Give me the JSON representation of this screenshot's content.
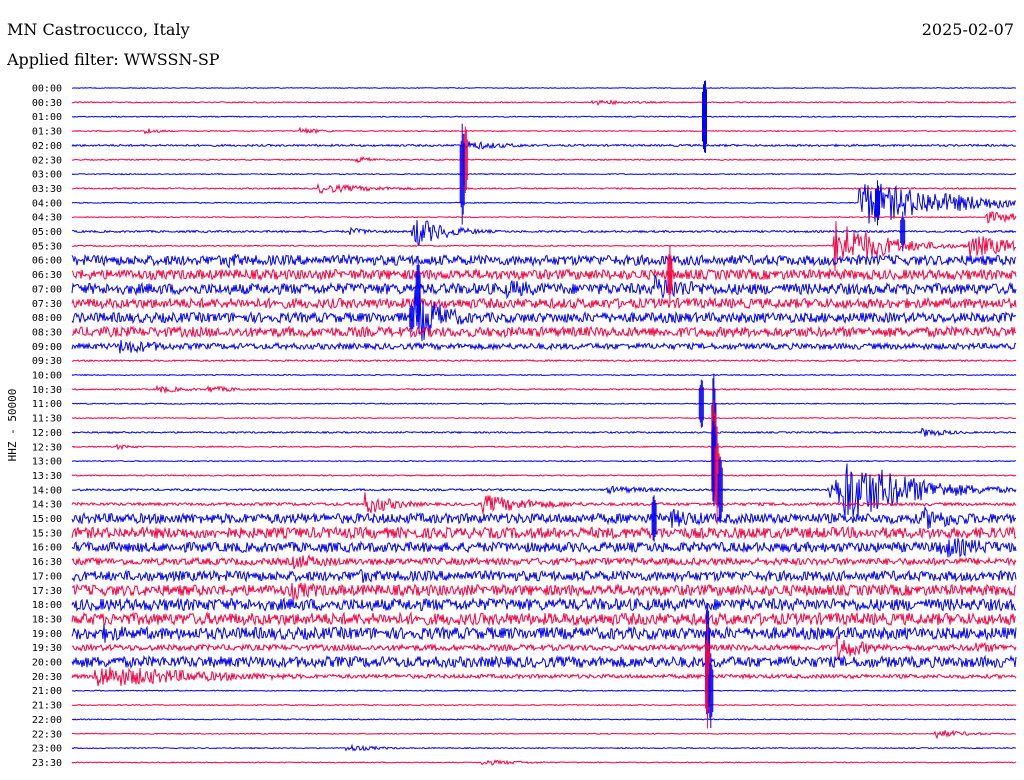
{
  "header": {
    "station": "MN Castrocucco, Italy",
    "date": "2025-02-07",
    "filter": "Applied filter: WWSSN-SP"
  },
  "chart_data": {
    "type": "helicorder",
    "ylabel": "HHZ - 50000",
    "row_colors": [
      "#0000ff",
      "#ff0040"
    ],
    "time_labels": [
      "00:00",
      "00:30",
      "01:00",
      "01:30",
      "02:00",
      "02:30",
      "03:00",
      "03:30",
      "04:00",
      "04:30",
      "05:00",
      "05:30",
      "06:00",
      "06:30",
      "07:00",
      "07:30",
      "08:00",
      "08:30",
      "09:00",
      "09:30",
      "10:00",
      "10:30",
      "11:00",
      "11:30",
      "12:00",
      "12:30",
      "13:00",
      "13:30",
      "14:00",
      "14:30",
      "15:00",
      "15:30",
      "16:00",
      "16:30",
      "17:00",
      "17:30",
      "18:00",
      "18:30",
      "19:00",
      "19:30",
      "20:00",
      "20:30",
      "21:00",
      "21:30",
      "22:00",
      "22:30",
      "23:00",
      "23:30"
    ],
    "row_minutes": 30,
    "noise_level": [
      0.4,
      0.6,
      0.5,
      0.5,
      1.0,
      0.6,
      0.5,
      0.7,
      0.5,
      0.5,
      1.0,
      0.6,
      5.0,
      5.0,
      5.5,
      5.0,
      5.0,
      5.0,
      3.0,
      0.8,
      0.5,
      0.7,
      0.5,
      0.5,
      0.8,
      0.6,
      0.5,
      0.6,
      1.0,
      1.5,
      5.0,
      5.5,
      5.0,
      3.5,
      5.0,
      5.5,
      6.0,
      6.0,
      6.0,
      3.0,
      5.5,
      2.0,
      0.5,
      0.5,
      0.5,
      0.5,
      0.5,
      0.5
    ],
    "events": [
      {
        "row": 1,
        "minute": 16.5,
        "amp": 3,
        "dur": 1.5
      },
      {
        "row": 3,
        "minute": 2.3,
        "amp": 4,
        "dur": 0.5
      },
      {
        "row": 3,
        "minute": 7.2,
        "amp": 4,
        "dur": 0.7
      },
      {
        "row": 4,
        "minute": 12.5,
        "amp": 5,
        "dur": 1.5
      },
      {
        "row": 5,
        "minute": 9.0,
        "amp": 4,
        "dur": 0.6
      },
      {
        "row": 7,
        "minute": 7.8,
        "amp": 5,
        "dur": 2.0
      },
      {
        "row": 8,
        "minute": 25.0,
        "amp": 24,
        "dur": 3.0
      },
      {
        "row": 9,
        "minute": 29.0,
        "amp": 6,
        "dur": 2.0
      },
      {
        "row": 10,
        "minute": 8.8,
        "amp": 4,
        "dur": 1.0
      },
      {
        "row": 10,
        "minute": 10.8,
        "amp": 18,
        "dur": 1.0
      },
      {
        "row": 11,
        "minute": 24.2,
        "amp": 28,
        "dur": 1.5
      },
      {
        "row": 11,
        "minute": 28.5,
        "amp": 12,
        "dur": 2.0
      },
      {
        "row": 12,
        "minute": 4.9,
        "amp": 9,
        "dur": 1.0
      },
      {
        "row": 14,
        "minute": 13.8,
        "amp": 10,
        "dur": 2.0
      },
      {
        "row": 14,
        "minute": 18.5,
        "amp": 14,
        "dur": 2.0
      },
      {
        "row": 16,
        "minute": 10.9,
        "amp": 30,
        "dur": 1.0
      },
      {
        "row": 18,
        "minute": 1.5,
        "amp": 8,
        "dur": 2.0
      },
      {
        "row": 21,
        "minute": 2.7,
        "amp": 4,
        "dur": 1.0
      },
      {
        "row": 21,
        "minute": 4.3,
        "amp": 4,
        "dur": 1.0
      },
      {
        "row": 24,
        "minute": 27.0,
        "amp": 5,
        "dur": 1.0
      },
      {
        "row": 25,
        "minute": 1.4,
        "amp": 3,
        "dur": 0.6
      },
      {
        "row": 28,
        "minute": 17.0,
        "amp": 4,
        "dur": 2.0
      },
      {
        "row": 28,
        "minute": 24.0,
        "amp": 16,
        "dur": 2.5
      },
      {
        "row": 28,
        "minute": 24.5,
        "amp": 38,
        "dur": 2.0
      },
      {
        "row": 28,
        "minute": 25.0,
        "amp": 14,
        "dur": 2.0
      },
      {
        "row": 29,
        "minute": 9.3,
        "amp": 12,
        "dur": 1.0
      },
      {
        "row": 29,
        "minute": 13.0,
        "amp": 10,
        "dur": 2.0
      },
      {
        "row": 30,
        "minute": 19.0,
        "amp": 10,
        "dur": 2.0
      },
      {
        "row": 30,
        "minute": 27.0,
        "amp": 12,
        "dur": 2.0
      },
      {
        "row": 32,
        "minute": 5.3,
        "amp": 6,
        "dur": 1.0
      },
      {
        "row": 32,
        "minute": 27.5,
        "amp": 12,
        "dur": 2.5
      },
      {
        "row": 33,
        "minute": 7.0,
        "amp": 8,
        "dur": 2.0
      },
      {
        "row": 34,
        "minute": 9.0,
        "amp": 8,
        "dur": 2.0
      },
      {
        "row": 35,
        "minute": 6.9,
        "amp": 10,
        "dur": 2.0
      },
      {
        "row": 38,
        "minute": 1.0,
        "amp": 10,
        "dur": 1.5
      },
      {
        "row": 39,
        "minute": 24.3,
        "amp": 14,
        "dur": 1.0
      },
      {
        "row": 39,
        "minute": 28.5,
        "amp": 6,
        "dur": 2.0
      },
      {
        "row": 41,
        "minute": 0.7,
        "amp": 12,
        "dur": 4.0
      },
      {
        "row": 45,
        "minute": 27.4,
        "amp": 5,
        "dur": 1.0
      },
      {
        "row": 46,
        "minute": 8.7,
        "amp": 4,
        "dur": 1.0
      },
      {
        "row": 47,
        "minute": 13.0,
        "amp": 3,
        "dur": 1.5
      }
    ],
    "quake": [
      {
        "row": 2,
        "minute": 20.1,
        "amp": 50
      },
      {
        "row": 5,
        "minute": 12.5,
        "amp": 40
      },
      {
        "row": 6,
        "minute": 12.4,
        "amp": 60
      },
      {
        "row": 8,
        "minute": 25.6,
        "amp": 26
      },
      {
        "row": 10,
        "minute": 26.4,
        "amp": 22
      },
      {
        "row": 13,
        "minute": 19.0,
        "amp": 34
      },
      {
        "row": 14,
        "minute": 11.0,
        "amp": 34
      },
      {
        "row": 16,
        "minute": 10.8,
        "amp": 20
      },
      {
        "row": 22,
        "minute": 20.0,
        "amp": 30
      },
      {
        "row": 24,
        "minute": 20.4,
        "amp": 70
      },
      {
        "row": 25,
        "minute": 20.4,
        "amp": 60
      },
      {
        "row": 26,
        "minute": 20.4,
        "amp": 55
      },
      {
        "row": 27,
        "minute": 20.5,
        "amp": 50
      },
      {
        "row": 28,
        "minute": 20.6,
        "amp": 40
      },
      {
        "row": 30,
        "minute": 18.5,
        "amp": 30
      },
      {
        "row": 40,
        "minute": 20.2,
        "amp": 70
      },
      {
        "row": 41,
        "minute": 20.2,
        "amp": 60
      },
      {
        "row": 42,
        "minute": 20.3,
        "amp": 40
      }
    ]
  }
}
